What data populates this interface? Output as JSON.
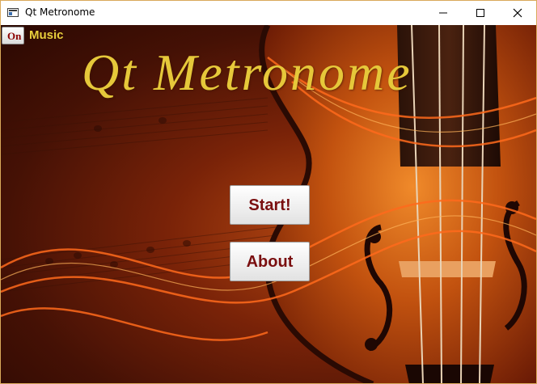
{
  "window": {
    "title": "Qt Metronome",
    "app_icon": "window-app-icon",
    "controls": [
      "minimize-icon",
      "maximize-icon",
      "close-icon"
    ]
  },
  "music": {
    "toggle_label": "On",
    "label": "Music"
  },
  "main": {
    "title": "Qt Metronome",
    "buttons": {
      "start": "Start!",
      "about": "About"
    }
  },
  "colors": {
    "title_text": "#e6c83a",
    "music_label": "#e8cf3c",
    "button_text": "#7a0f10",
    "background": "#7a2308"
  }
}
